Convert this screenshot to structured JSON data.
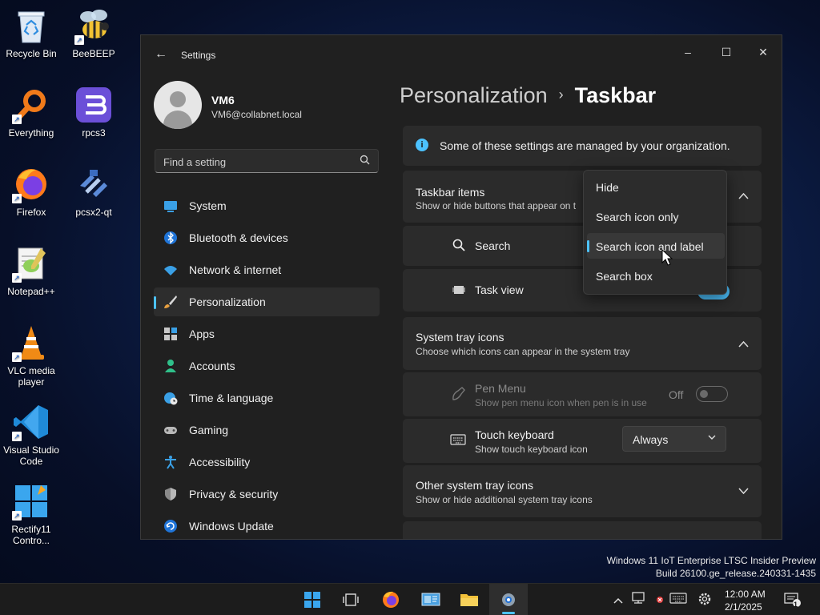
{
  "desktop": {
    "icons": [
      {
        "label": "Recycle Bin"
      },
      {
        "label": "BeeBEEP"
      },
      {
        "label": "Everything"
      },
      {
        "label": "rpcs3"
      },
      {
        "label": "Firefox"
      },
      {
        "label": "pcsx2-qt"
      },
      {
        "label": "Notepad++"
      },
      {
        "label": "VLC media player"
      },
      {
        "label": "Visual Studio Code"
      },
      {
        "label": "Rectify11 Contro..."
      }
    ]
  },
  "window": {
    "title": "Settings",
    "controls": {
      "minimize": "–",
      "maximize": "☐",
      "close": "✕"
    },
    "profile": {
      "name": "VM6",
      "email": "VM6@collabnet.local"
    },
    "search": {
      "placeholder": "Find a setting"
    },
    "nav": [
      {
        "label": "System",
        "icon": "monitor-icon"
      },
      {
        "label": "Bluetooth & devices",
        "icon": "bluetooth-icon"
      },
      {
        "label": "Network & internet",
        "icon": "wifi-icon"
      },
      {
        "label": "Personalization",
        "icon": "brush-icon",
        "active": true
      },
      {
        "label": "Apps",
        "icon": "apps-icon"
      },
      {
        "label": "Accounts",
        "icon": "person-icon"
      },
      {
        "label": "Time & language",
        "icon": "globe-clock-icon"
      },
      {
        "label": "Gaming",
        "icon": "gamepad-icon"
      },
      {
        "label": "Accessibility",
        "icon": "accessibility-icon"
      },
      {
        "label": "Privacy & security",
        "icon": "shield-icon"
      },
      {
        "label": "Windows Update",
        "icon": "update-icon"
      }
    ],
    "breadcrumb": {
      "parent": "Personalization",
      "separator": "›",
      "current": "Taskbar"
    },
    "info_banner": "Some of these settings are managed by your organization.",
    "taskbar_items": {
      "title": "Taskbar items",
      "subtitle": "Show or hide buttons that appear on t",
      "search_label": "Search",
      "task_view_label": "Task view"
    },
    "search_menu": {
      "options": [
        "Hide",
        "Search icon only",
        "Search icon and label",
        "Search box"
      ],
      "selected": "Search icon and label"
    },
    "system_tray": {
      "title": "System tray icons",
      "subtitle": "Choose which icons can appear in the system tray",
      "pen_menu": {
        "title": "Pen Menu",
        "subtitle": "Show pen menu icon when pen is in use",
        "state": "Off"
      },
      "touch_keyboard": {
        "title": "Touch keyboard",
        "subtitle": "Show touch keyboard icon",
        "value": "Always"
      }
    },
    "other_tray": {
      "title": "Other system tray icons",
      "subtitle": "Show or hide additional system tray icons"
    }
  },
  "watermark": {
    "line1": "Windows 11 IoT Enterprise LTSC Insider Preview",
    "line2": "Build 26100.ge_release.240331-1435"
  },
  "taskbar": {
    "time": "12:00 AM",
    "date": "2/1/2025",
    "notification_count": "1"
  },
  "colors": {
    "accent": "#4cc2ff",
    "window_bg": "#202020",
    "card_bg": "#2b2b2b"
  }
}
